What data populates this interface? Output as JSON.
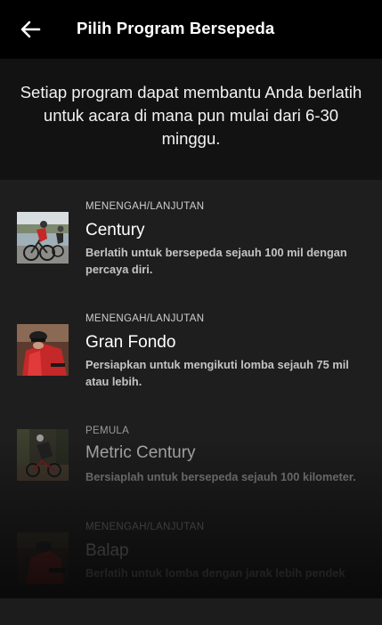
{
  "header": {
    "back_icon": "arrow-left-icon",
    "title": "Pilih Program Bersepeda"
  },
  "intro": {
    "text": "Setiap program dapat membantu Anda berlatih untuk acara di mana pun mulai dari 6-30 minggu."
  },
  "programs": [
    {
      "level": "MENENGAH/LANJUTAN",
      "name": "Century",
      "description": "Berlatih untuk bersepeda sejauh 100 mil dengan percaya diri.",
      "image": "cyclists-road-photo"
    },
    {
      "level": "MENENGAH/LANJUTAN",
      "name": "Gran Fondo",
      "description": "Persiapkan untuk mengikuti lomba sejauh 75 mil atau lebih.",
      "image": "cyclist-red-jersey-photo"
    },
    {
      "level": "PEMULA",
      "name": "Metric Century",
      "description": "Bersiaplah untuk bersepeda sejauh 100 kilometer.",
      "image": "cyclist-forest-photo"
    },
    {
      "level": "MENENGAH/LANJUTAN",
      "name": "Balap",
      "description": "Berlatih untuk lomba dengan jarak lebih pendek",
      "image": "cyclist-racing-photo"
    }
  ],
  "colors": {
    "appbar_bg": "#000000",
    "intro_bg": "#121212",
    "list_bg": "#1e1e1e",
    "jersey_red": "#c42828"
  }
}
